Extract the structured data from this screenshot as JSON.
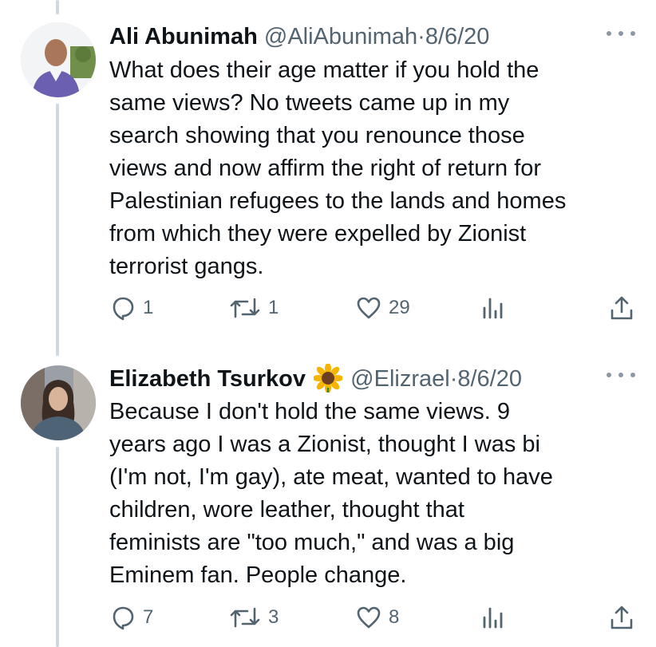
{
  "tweets": [
    {
      "name": "Ali Abunimah",
      "handle": "@AliAbunimah",
      "separator": "·",
      "date": "8/6/20",
      "text": "What does their age matter if you hold the\nsame views? No tweets came up in my\nsearch showing that you renounce those\nviews and now affirm the right of return for\nPalestinian refugees to the lands and homes\nfrom which they were expelled by Zionist\nterrorist gangs.",
      "reply_count": "1",
      "retweet_count": "1",
      "like_count": "29"
    },
    {
      "name": "Elizabeth Tsurkov",
      "name_emoji": "sunflower-emoji",
      "handle": "@Elizrael",
      "separator": "·",
      "date": "8/6/20",
      "text": "Because I don't hold the same views. 9\nyears ago I was a Zionist, thought I was bi\n(I'm not, I'm gay), ate meat, wanted to have\nchildren, wore leather, thought that\nfeminists are \"too much,\" and was a big\nEminem fan. People change.",
      "reply_count": "7",
      "retweet_count": "3",
      "like_count": "8"
    }
  ],
  "icons": {
    "reply": "reply-icon",
    "retweet": "retweet-icon",
    "like": "heart-icon",
    "analytics": "analytics-icon",
    "share": "share-icon",
    "more": "more-icon"
  },
  "colors": {
    "text": "#0f1419",
    "secondary": "#536471",
    "thread_line": "#cfd9de"
  }
}
